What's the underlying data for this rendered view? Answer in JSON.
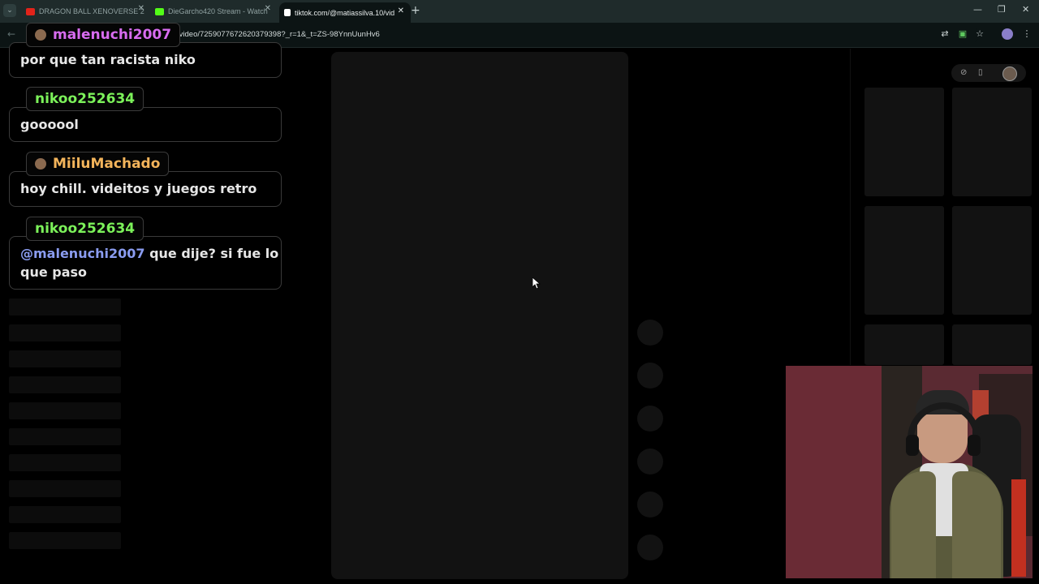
{
  "browser": {
    "tabs": [
      {
        "title": "DRAGON BALL XENOVERSE 2",
        "favicon_color": "#e2231a",
        "active": false
      },
      {
        "title": "DieGarcho420 Stream - Watch",
        "favicon_color": "#53fc18",
        "active": false
      },
      {
        "title": "tiktok.com/@matiassilva.10/vid",
        "favicon_color": "#ffffff",
        "active": true
      }
    ],
    "url": "/video/7259077672620379398?_r=1&_t=ZS-98YnnUunHv6"
  },
  "chat": {
    "messages": [
      {
        "username": "malenuchi2007",
        "username_color": "#d86cf0",
        "has_avatar": true,
        "mention": "",
        "text": "por que tan racista niko"
      },
      {
        "username": "nikoo252634",
        "username_color": "#7cf25a",
        "has_avatar": false,
        "mention": "",
        "text": "goooool"
      },
      {
        "username": "MiiluMachado",
        "username_color": "#f3b45b",
        "has_avatar": true,
        "mention": "",
        "text": "hoy chill. videitos y juegos retro"
      },
      {
        "username": "nikoo252634",
        "username_color": "#7cf25a",
        "has_avatar": false,
        "mention": "@malenuchi2007",
        "text": "que dije? si fue lo",
        "text_line2": "que paso"
      }
    ]
  },
  "icons": {
    "compass": "compass-icon",
    "phone": "phone-icon",
    "translate": "translate-icon",
    "star": "star-icon",
    "menu": "kebab-menu-icon"
  }
}
